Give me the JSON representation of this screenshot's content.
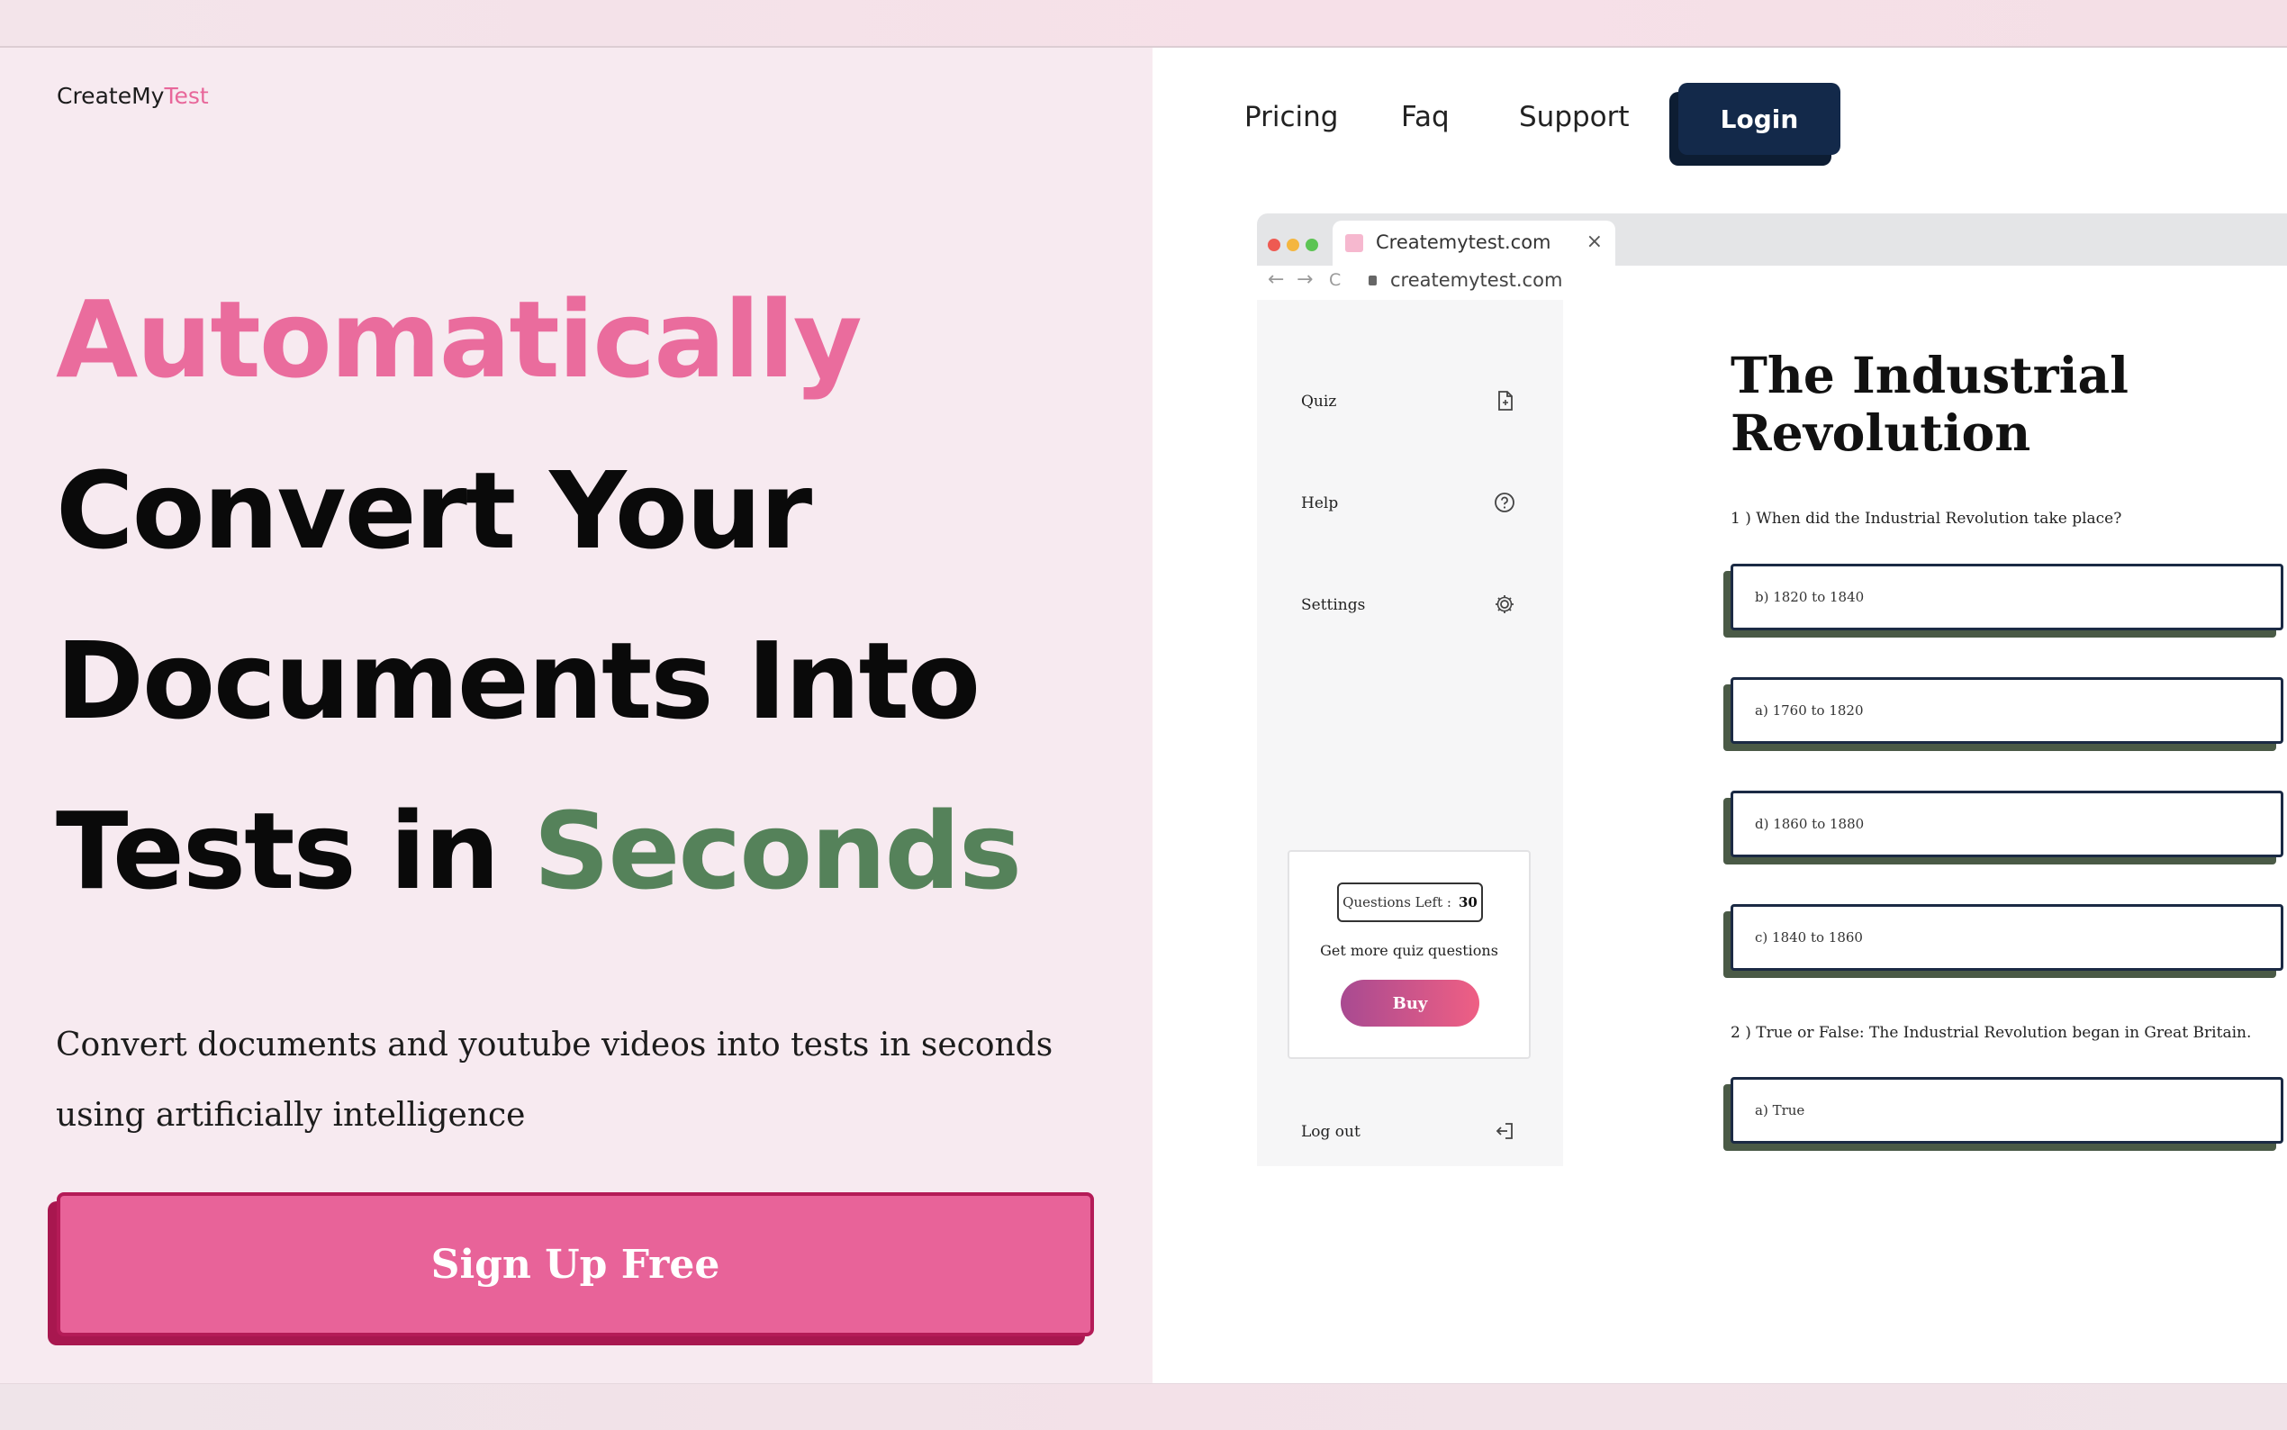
{
  "logo": {
    "part1": "CreateMy",
    "part2": "Test"
  },
  "hero": {
    "line1": "Automatically",
    "line2": "Convert Your",
    "line3": "Documents Into",
    "line4_a": "Tests in ",
    "line4_b": "Seconds",
    "subtitle": "Convert documents and youtube videos into tests in seconds using artificially intelligence",
    "cta_label": "Sign Up Free"
  },
  "nav": {
    "pricing": "Pricing",
    "faq": "Faq",
    "support": "Support",
    "login": "Login"
  },
  "browser": {
    "tab_title": "Createmytest.com",
    "close_glyph": "×",
    "back_glyph": "←",
    "forward_glyph": "→",
    "reload_glyph": "C",
    "url": "createmytest.com"
  },
  "sidebar": {
    "quiz": "Quiz",
    "help": "Help",
    "settings": "Settings",
    "logout": "Log out",
    "questions_left_label": "Questions Left :",
    "questions_left_value": "30",
    "get_more": "Get more quiz questions",
    "buy": "Buy"
  },
  "quiz": {
    "title": "The Industrial Revolution",
    "q1": "1 ) When did the Industrial Revolution take place?",
    "q1_options": [
      "b)  1820 to 1840",
      "a)  1760 to 1820",
      "d)  1860 to 1880",
      "c)  1840 to 1860"
    ],
    "q2": "2 ) True or False: The Industrial Revolution began in Great Britain.",
    "q2_options": [
      "a)  True"
    ]
  },
  "colors": {
    "pink": "#e86399",
    "green": "#55825a",
    "navy": "#13294a"
  }
}
